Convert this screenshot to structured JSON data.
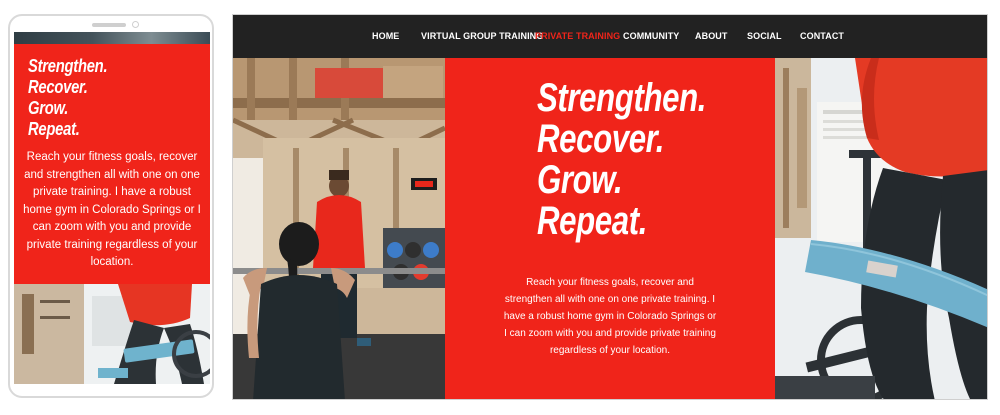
{
  "headline": [
    "Strengthen.",
    "Recover.",
    "Grow.",
    "Repeat."
  ],
  "body": "Reach your fitness goals, recover and strengthen all with one on one private training. I have a robust home gym in Colorado Springs or I can zoom with you and provide private training regardless of your location.",
  "nav": {
    "items": [
      {
        "label": "HOME",
        "active": false
      },
      {
        "label": "VIRTUAL GROUP TRAINING",
        "active": false
      },
      {
        "label": "PRIVATE TRAINING",
        "active": true
      },
      {
        "label": "COMMUNITY",
        "active": false
      },
      {
        "label": "ABOUT",
        "active": false
      },
      {
        "label": "SOCIAL",
        "active": false
      },
      {
        "label": "CONTACT",
        "active": false
      }
    ]
  },
  "phone_band_label": "",
  "colors": {
    "accent_red": "#f0241a",
    "nav_background": "#222222",
    "text_white": "#ffffff"
  }
}
